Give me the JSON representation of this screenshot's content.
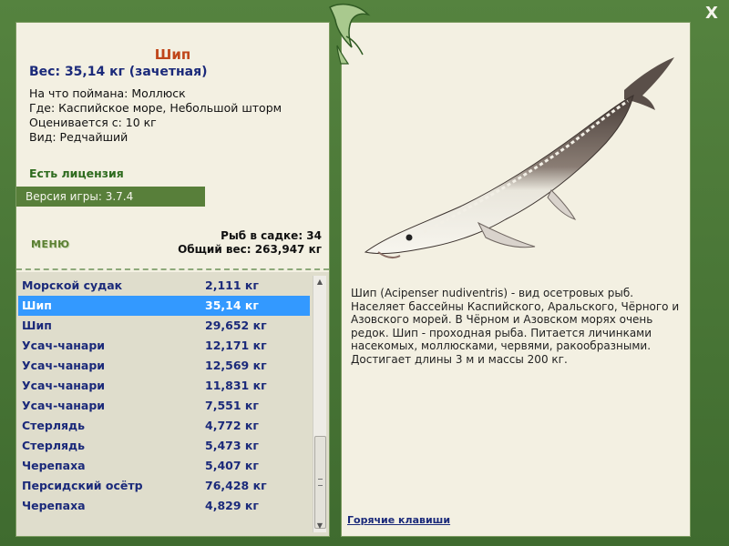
{
  "catch": {
    "name": "Шип",
    "weight_line": "Вес: 35,14 кг (зачетная)",
    "bait": "На что поймана: Моллюск",
    "where": "Где: Каспийское море, Небольшой шторм",
    "rated": "Оценивается с: 10 кг",
    "kind": "Вид: Редчайший"
  },
  "license": "Есть лицензия",
  "version": "Версия игры: 3.7.4",
  "menu_label": "МЕНЮ",
  "cage": {
    "count_line": "Рыб в садке: 34",
    "total_line": "Общий вес: 263,947 кг"
  },
  "fish_list": [
    {
      "name": "Морской судак",
      "weight": "2,111 кг"
    },
    {
      "name": "Шип",
      "weight": "35,14 кг",
      "selected": true
    },
    {
      "name": "Шип",
      "weight": "29,652 кг"
    },
    {
      "name": "Усач-чанари",
      "weight": "12,171 кг"
    },
    {
      "name": "Усач-чанари",
      "weight": "12,569 кг"
    },
    {
      "name": "Усач-чанари",
      "weight": "11,831 кг"
    },
    {
      "name": "Усач-чанари",
      "weight": "7,551 кг"
    },
    {
      "name": "Стерлядь",
      "weight": "4,772 кг"
    },
    {
      "name": "Стерлядь",
      "weight": "5,473 кг"
    },
    {
      "name": "Черепаха",
      "weight": "5,407 кг"
    },
    {
      "name": "Персидский осётр",
      "weight": "76,428 кг"
    },
    {
      "name": "Черепаха",
      "weight": "4,829 кг"
    }
  ],
  "description": "Шип (Acipenser nudiventris) - вид осетровых рыб. Населяет бассейны Каспийского, Аральского, Чёрного и Азовского морей. В Чёрном и Азовском морях очень редок. Шип - проходная рыба. Питается личинками насекомых, моллюсками, червями, ракообразными. Достигает длины 3 м и массы 200 кг.",
  "hotkeys_label": "Горячие клавиши",
  "close_label": "X",
  "colors": {
    "frame": "#4e7a3c",
    "panel": "#f3f0e2",
    "selected": "#3399ff",
    "name_accent": "#c0461a",
    "list_text": "#1b2a7a"
  },
  "icons": {
    "logo": "fish-logo-icon",
    "close": "close-icon",
    "scroll_up": "scroll-up-icon",
    "scroll_down": "scroll-down-icon"
  }
}
